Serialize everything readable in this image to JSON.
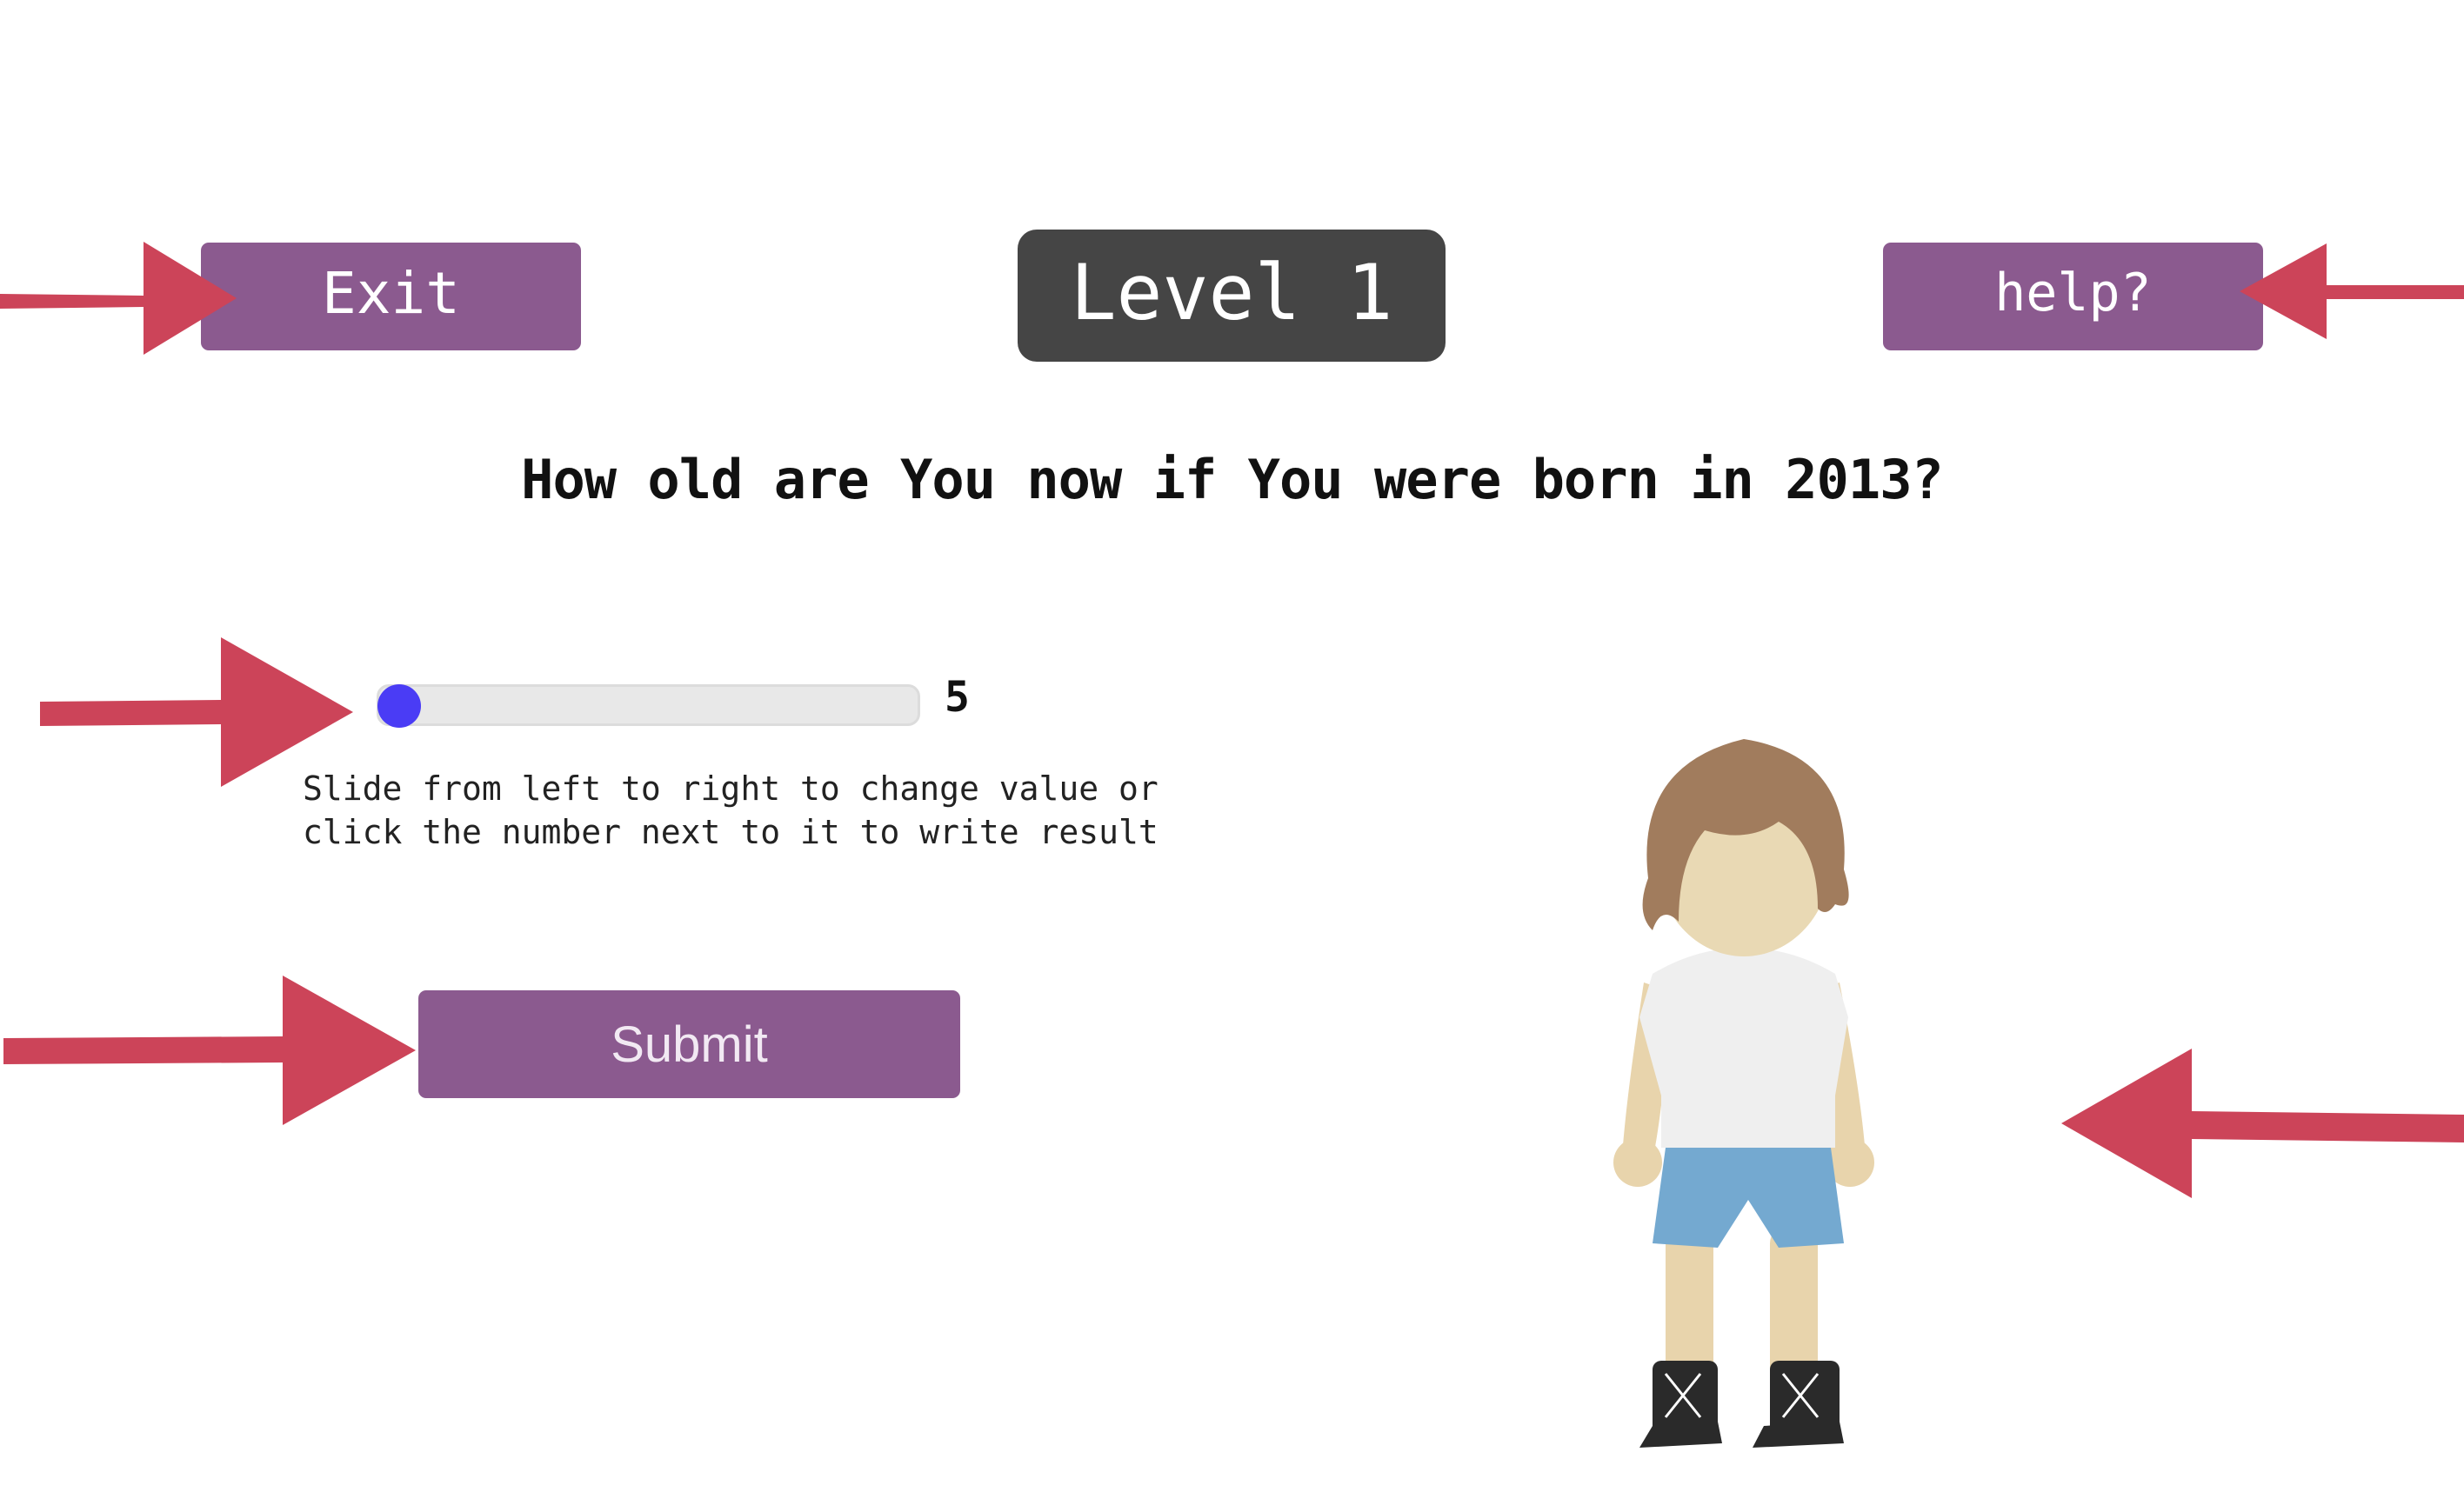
{
  "header": {
    "exit_label": "Exit",
    "level_label": "Level 1",
    "help_label": "help?"
  },
  "question": {
    "text": "How old are You now if You were born in 2013?"
  },
  "answer": {
    "slider_value": "5",
    "hint_line1": "Slide from left to right to change value or",
    "hint_line2": "click the number next to it to write result"
  },
  "actions": {
    "submit_label": "Submit"
  },
  "colors": {
    "button_purple": "#8b5a8f",
    "level_badge": "#454545",
    "slider_thumb": "#4a3cf5",
    "arrow_red": "#cc4459"
  },
  "icons": {
    "annotation_arrows": "arrow-icon",
    "character": "child-avatar"
  }
}
